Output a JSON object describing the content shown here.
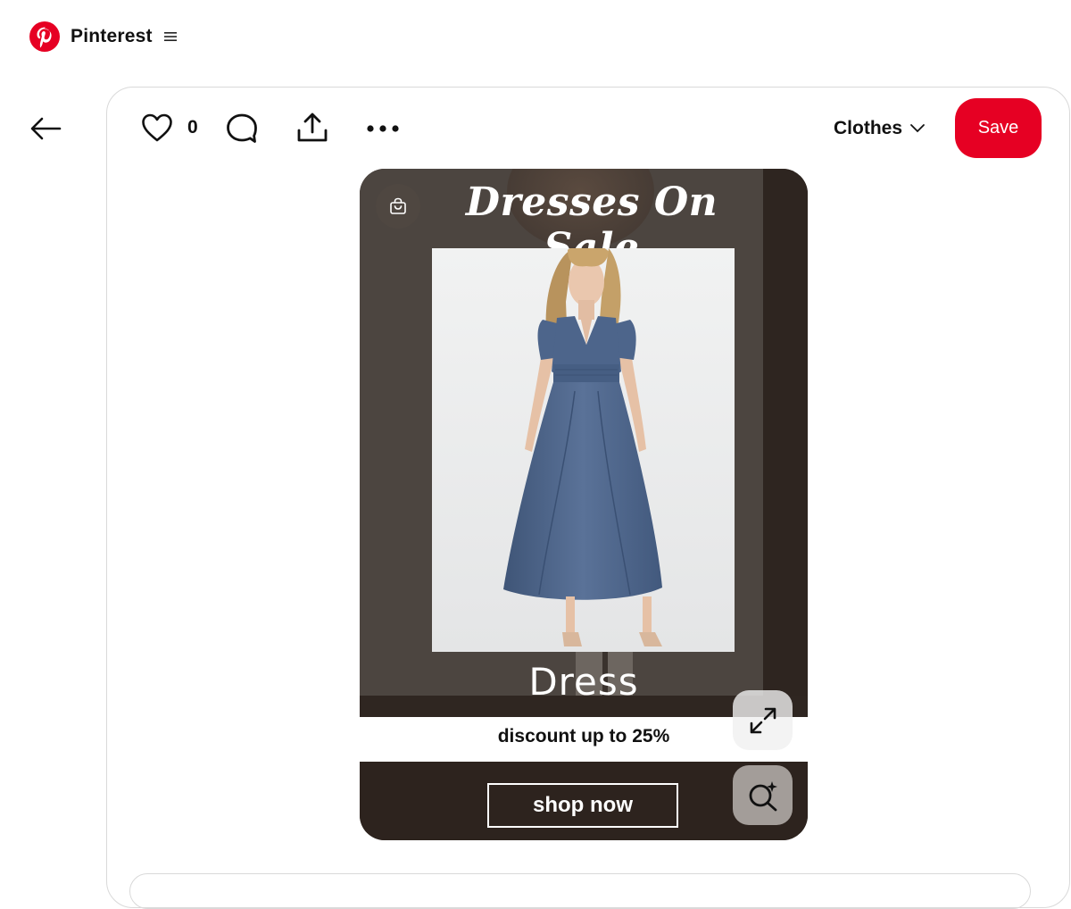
{
  "header": {
    "brand_name": "Pinterest",
    "brand_color": "#e60023",
    "icons": [
      "pinterest-logo-icon",
      "menu-icon"
    ]
  },
  "navigation": {
    "back_icon": "arrow-left-icon"
  },
  "toolbar": {
    "like_icon": "heart-icon",
    "likes_count": "0",
    "comment_icon": "comment-icon",
    "share_icon": "share-icon",
    "more_icon": "more-horizontal-icon",
    "board_name": "Clothes",
    "save_label": "Save",
    "save_color": "#e60023"
  },
  "pin": {
    "headline": "Dresses On Sale",
    "product_label": "Dress",
    "discount_text": "discount up to 25%",
    "cta_label": "shop now",
    "dress_color": "#4f6790",
    "icons": [
      "shopping-bag-icon",
      "expand-icon",
      "visual-search-icon"
    ]
  }
}
